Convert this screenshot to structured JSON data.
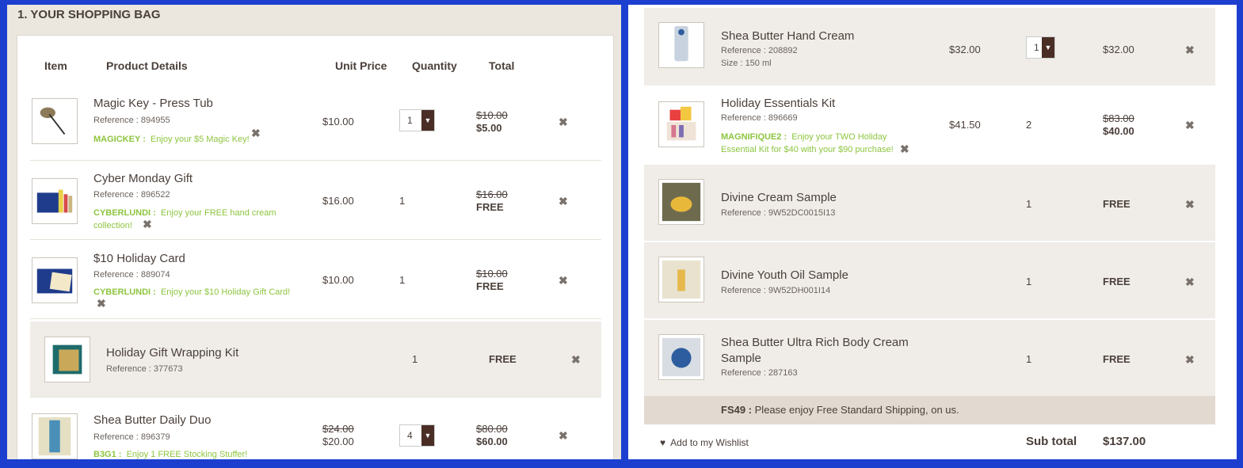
{
  "left": {
    "title": "1. YOUR SHOPPING BAG",
    "headers": {
      "item": "Item",
      "details": "Product Details",
      "unit": "Unit Price",
      "qty": "Quantity",
      "total": "Total"
    },
    "rows": [
      {
        "name": "Magic Key - Press Tub",
        "ref": "Reference : 894955",
        "promo_code": "MAGICKEY :",
        "promo_text": "Enjoy your $5 Magic Key!",
        "unit": "$10.00",
        "qty": "1",
        "total_old": "$10.00",
        "total_new": "$5.00"
      },
      {
        "name": "Cyber Monday Gift",
        "ref": "Reference : 896522",
        "promo_code": "CYBERLUNDI :",
        "promo_text": "Enjoy your FREE hand cream collection!",
        "unit": "$16.00",
        "qty": "1",
        "total_old": "$16.00",
        "total_new": "FREE"
      },
      {
        "name": "$10 Holiday Card",
        "ref": "Reference : 889074",
        "promo_code": "CYBERLUNDI :",
        "promo_text": "Enjoy your $10 Holiday Gift Card!",
        "unit": "$10.00",
        "qty": "1",
        "total_old": "$10.00",
        "total_new": "FREE"
      },
      {
        "name": "Holiday Gift Wrapping Kit",
        "ref": "Reference : 377673",
        "qty": "1",
        "total_new": "FREE"
      },
      {
        "name": "Shea Butter Daily Duo",
        "ref": "Reference : 896379",
        "promo_code": "B3G1 :",
        "promo_text": "Enjoy 1 FREE Stocking Stuffer!",
        "unit_old": "$24.00",
        "unit_new": "$20.00",
        "qty": "4",
        "total_old": "$80.00",
        "total_new": "$60.00"
      }
    ]
  },
  "right": {
    "rows": [
      {
        "name": "Shea Butter Hand Cream",
        "ref": "Reference : 208892",
        "size": "Size : 150 ml",
        "unit": "$32.00",
        "qty": "1",
        "total": "$32.00"
      },
      {
        "name": "Holiday Essentials Kit",
        "ref": "Reference : 896669",
        "promo_code": "MAGNIFIQUE2 :",
        "promo_text": "Enjoy your TWO Holiday Essential Kit for $40 with your $90 purchase!",
        "unit": "$41.50",
        "qty": "2",
        "total_old": "$83.00",
        "total_new": "$40.00"
      },
      {
        "name": "Divine Cream Sample",
        "ref": "Reference : 9W52DC0015I13",
        "qty": "1",
        "total": "FREE"
      },
      {
        "name": "Divine Youth Oil Sample",
        "ref": "Reference : 9W52DH001I14",
        "qty": "1",
        "total": "FREE"
      },
      {
        "name": "Shea Butter Ultra Rich Body Cream Sample",
        "ref": "Reference : 287163",
        "qty": "1",
        "total": "FREE"
      }
    ],
    "shipping_code": "FS49 :",
    "shipping_text": "Please enjoy Free Standard Shipping, on us.",
    "wishlist": "Add to my Wishlist",
    "subtotal_label": "Sub total",
    "subtotal_value": "$137.00"
  },
  "icons": {
    "remove": "close-icon",
    "heart": "heart-icon",
    "dropdown": "chevron-down-icon"
  },
  "colors": {
    "promo": "#8dc53f",
    "frame": "#1c3fd0",
    "dropdown": "#4a2e25"
  }
}
